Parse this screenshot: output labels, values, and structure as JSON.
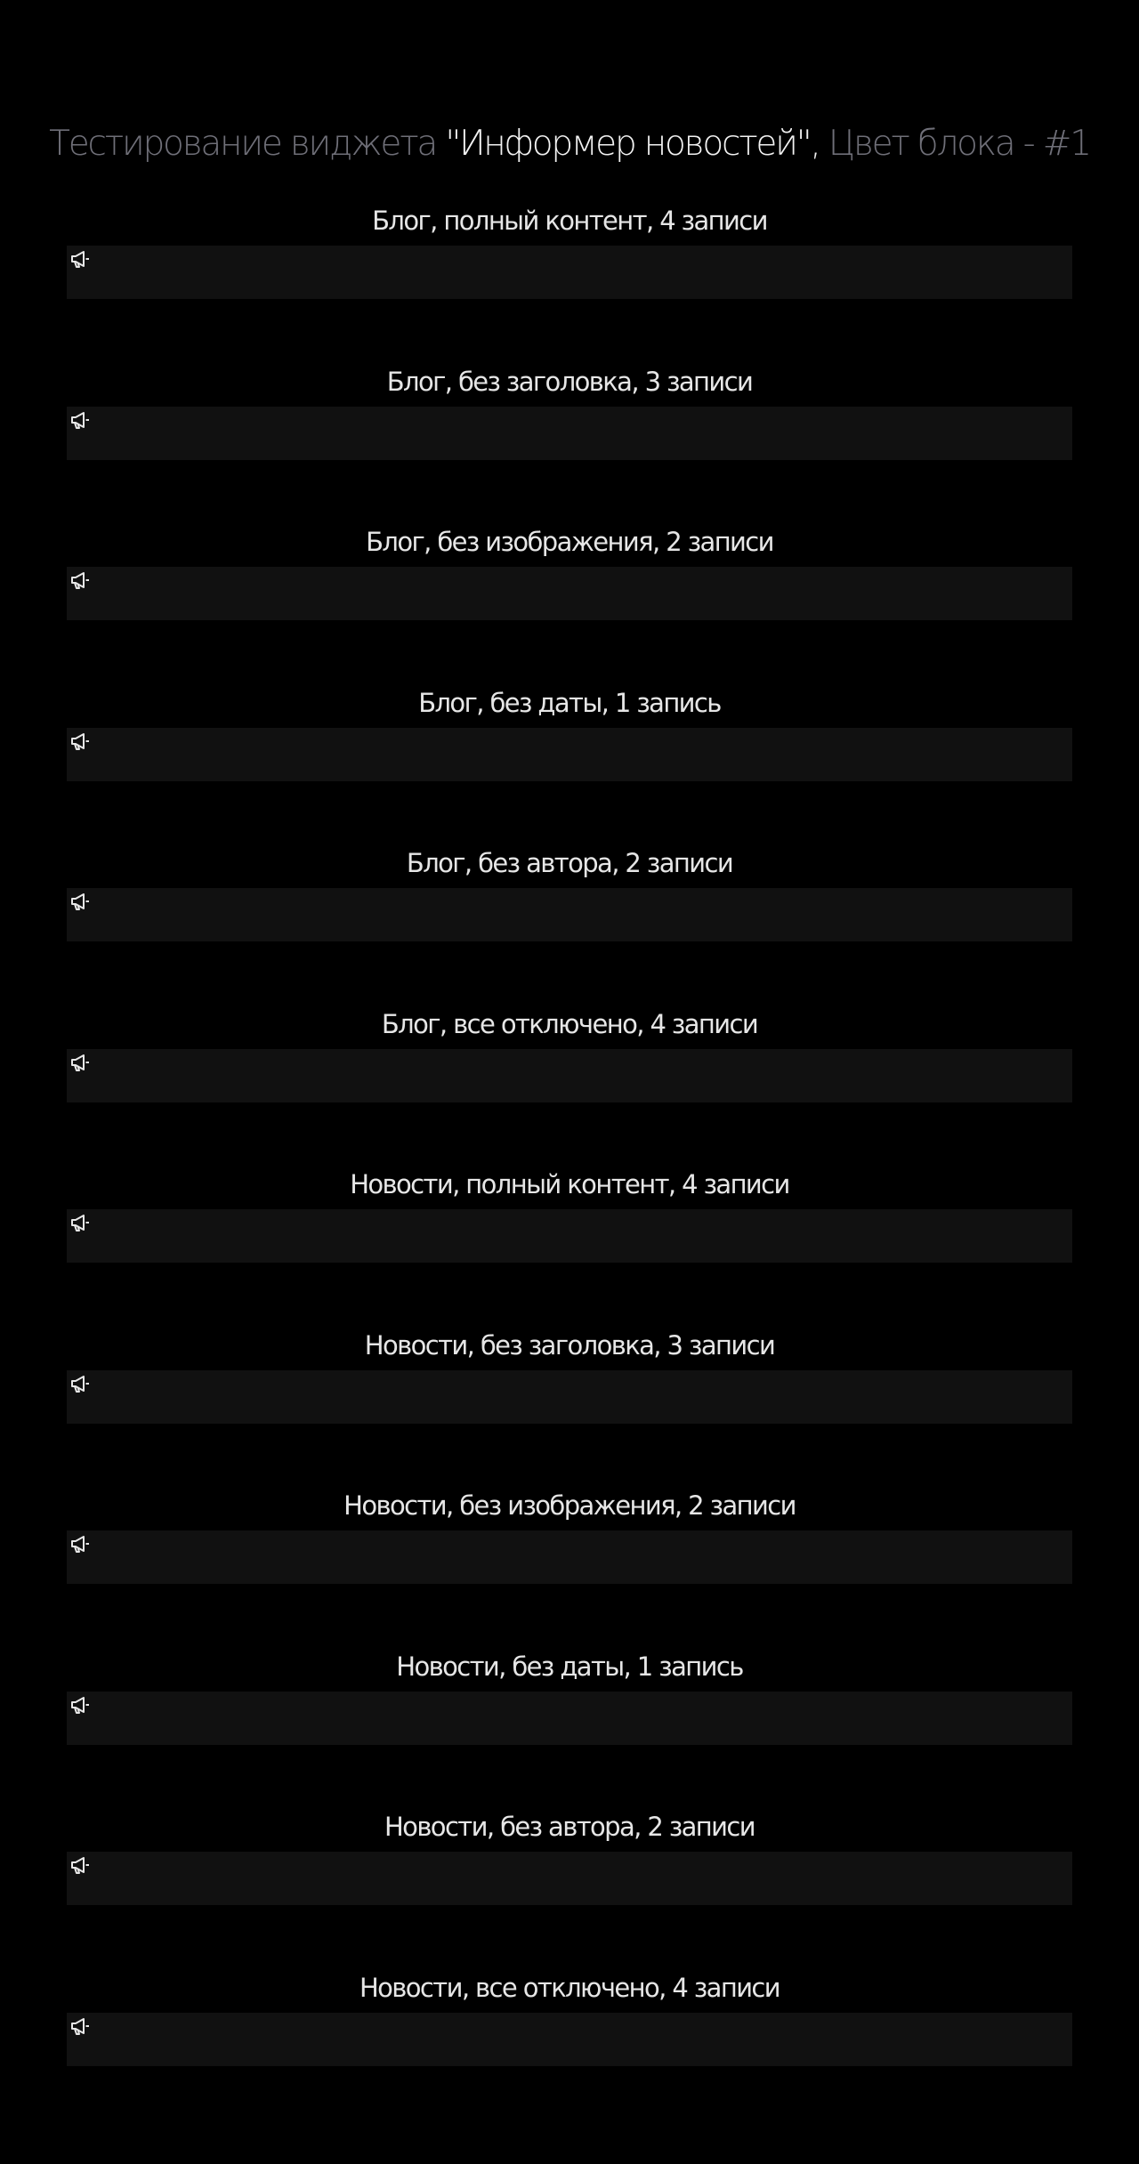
{
  "header": {
    "title_prefix": "Тестирование виджета",
    "widget_name": "\"Информер новостей\",",
    "block_color_label": "Цвет блока - #1"
  },
  "sections": [
    {
      "title": "Блог, полный контент, 4 записи",
      "icon": "megaphone-icon"
    },
    {
      "title": "Блог, без заголовка, 3 записи",
      "icon": "megaphone-icon"
    },
    {
      "title": "Блог, без изображения, 2 записи",
      "icon": "megaphone-icon"
    },
    {
      "title": "Блог, без даты, 1 запись",
      "icon": "megaphone-icon"
    },
    {
      "title": "Блог, без автора, 2 записи",
      "icon": "megaphone-icon"
    },
    {
      "title": "Блог, все отключено, 4 записи",
      "icon": "megaphone-icon"
    },
    {
      "title": "Новости, полный контент, 4 записи",
      "icon": "megaphone-icon"
    },
    {
      "title": "Новости, без заголовка, 3 записи",
      "icon": "megaphone-icon"
    },
    {
      "title": "Новости, без изображения, 2 записи",
      "icon": "megaphone-icon"
    },
    {
      "title": "Новости, без даты, 1 запись",
      "icon": "megaphone-icon"
    },
    {
      "title": "Новости, без автора, 2 записи",
      "icon": "megaphone-icon"
    },
    {
      "title": "Новости, все отключено, 4 записи",
      "icon": "megaphone-icon"
    }
  ],
  "colors": {
    "background": "#000000",
    "widget_background": "#111111",
    "title_dim": "#6f6f78",
    "title_bright": "#f2f2f2"
  }
}
